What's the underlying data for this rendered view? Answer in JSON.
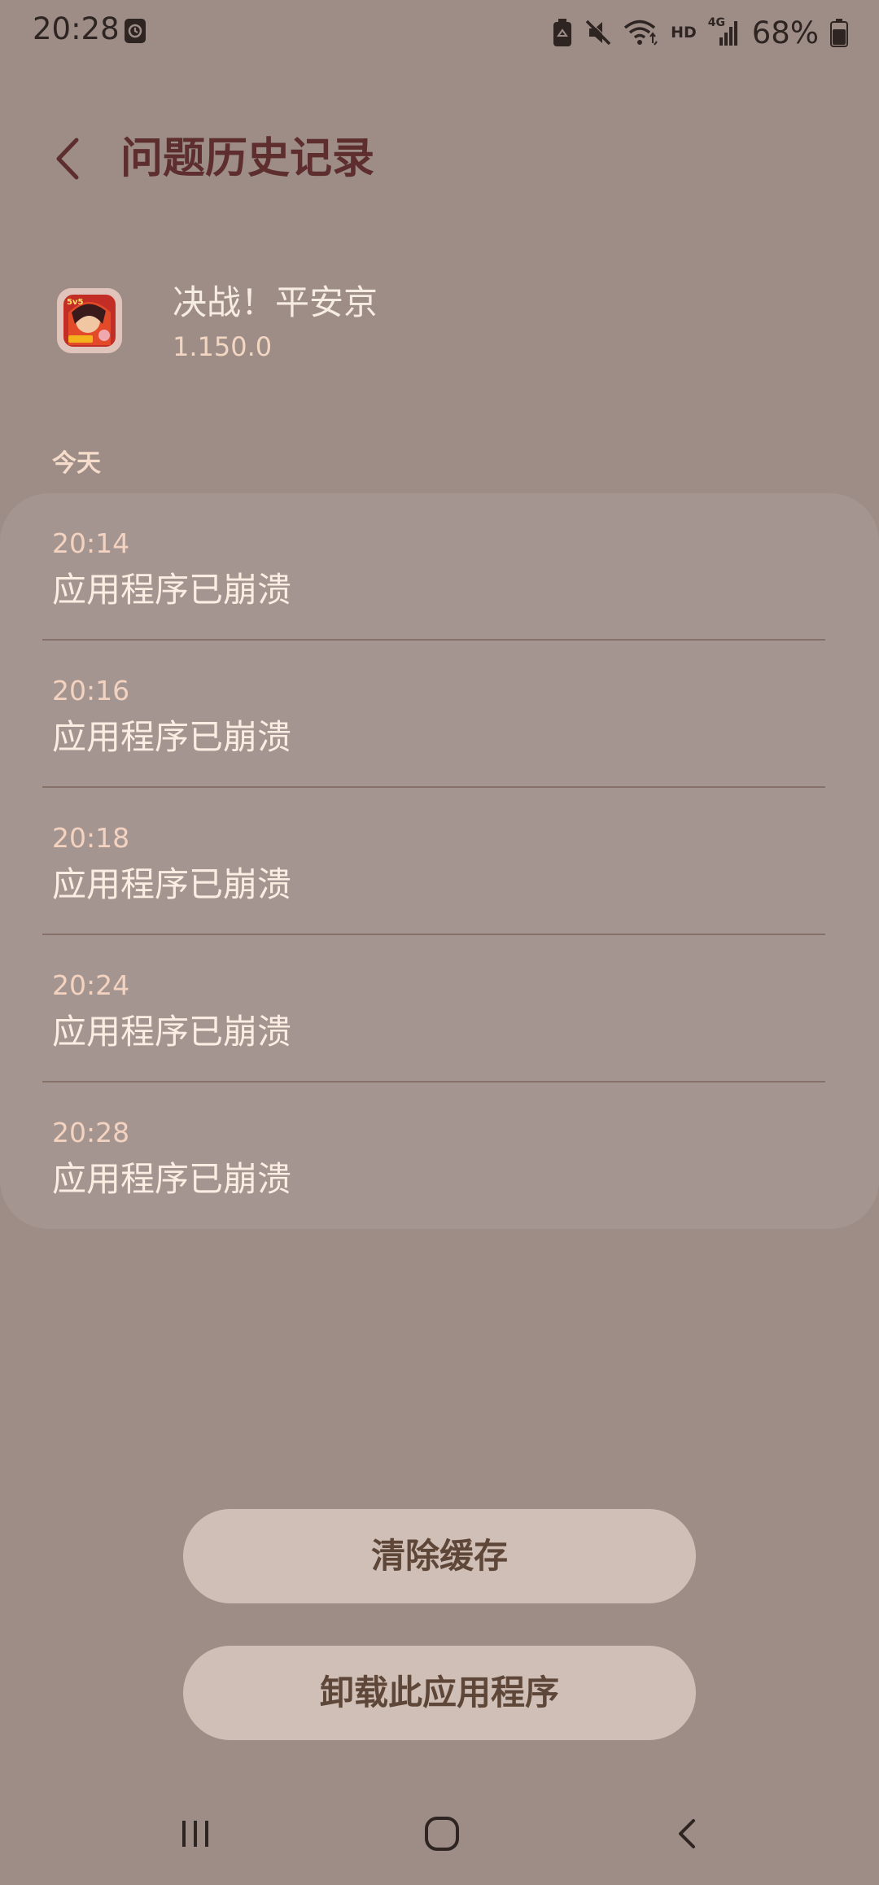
{
  "status_bar": {
    "time": "20:28",
    "network_badge": "HD",
    "network_type": "4G",
    "battery": "68%"
  },
  "header": {
    "title": "问题历史记录"
  },
  "app": {
    "name": "决战！平安京",
    "version": "1.150.0"
  },
  "section": {
    "label": "今天"
  },
  "crash_history": [
    {
      "time": "20:14",
      "message": "应用程序已崩溃"
    },
    {
      "time": "20:16",
      "message": "应用程序已崩溃"
    },
    {
      "time": "20:18",
      "message": "应用程序已崩溃"
    },
    {
      "time": "20:24",
      "message": "应用程序已崩溃"
    },
    {
      "time": "20:28",
      "message": "应用程序已崩溃"
    }
  ],
  "buttons": {
    "clear_cache": "清除缓存",
    "uninstall": "卸载此应用程序"
  },
  "colors": {
    "background": "#9d8d86",
    "card": "#a59591",
    "title": "#5e2e2e",
    "button_bg": "#d0bfb6",
    "button_text": "#5e4738"
  }
}
